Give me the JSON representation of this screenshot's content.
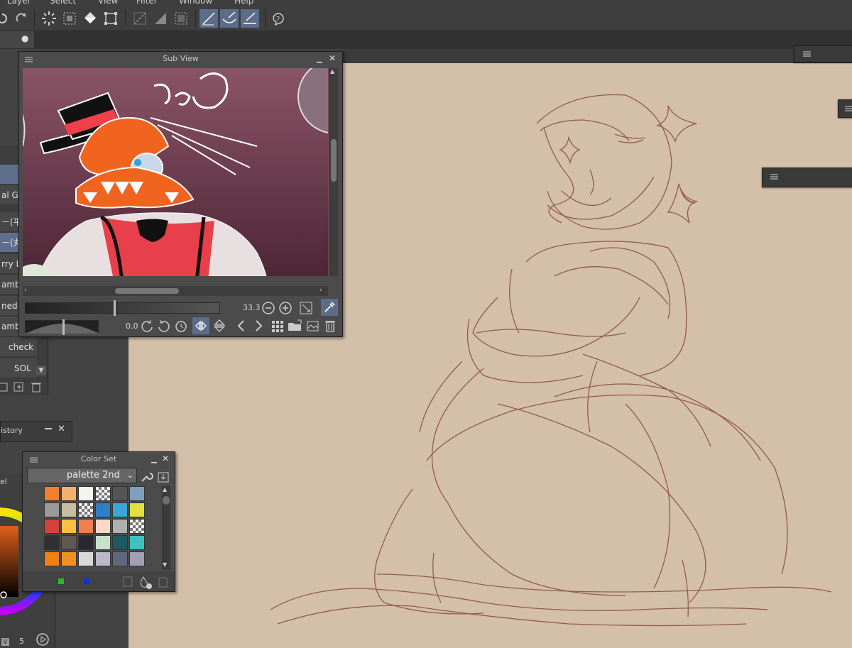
{
  "menu": {
    "items": [
      "Layer",
      "Select",
      "View",
      "Filter",
      "Window",
      "Help"
    ]
  },
  "toolbar": {
    "tools": [
      "redo-icon",
      "fill-icon",
      "selection-icon",
      "bucket-icon",
      "transform-icon",
      "ruler-icon",
      "grid-icon",
      "frame-icon",
      "pen-snap-icon",
      "curve-snap-icon",
      "line-snap-icon",
      "help-icon"
    ]
  },
  "subview": {
    "title": "Sub View",
    "zoom_value": "33.3",
    "rotation_value": "0.0"
  },
  "brushes": {
    "items": [
      {
        "label": "",
        "selected": true
      },
      {
        "label": "al G-l",
        "selected": false
      },
      {
        "label": "－(平",
        "selected": false
      },
      {
        "label": "－(丸",
        "selected": true
      },
      {
        "label": "rry L",
        "selected": false
      },
      {
        "label": "amb",
        "selected": false
      },
      {
        "label": "ned S",
        "selected": false
      },
      {
        "label": "amb",
        "selected": false
      },
      {
        "label": "check",
        "selected": false
      },
      {
        "label": "SOL",
        "selected": false
      }
    ]
  },
  "history": {
    "title": "istory"
  },
  "colorset": {
    "title": "Color Set",
    "palette_name": "palette 2nd",
    "swatches": [
      [
        "#f08030",
        "#f6b070",
        "#f5f5f0",
        "checker",
        "#555555",
        "#7e9fc0"
      ],
      [
        "#9a9a9a",
        "#c8bda0",
        "checker",
        "#2f7fc8",
        "#39a8d8",
        "#e0e040"
      ],
      [
        "#d84040",
        "#f8c040",
        "#f08050",
        "#f8d8c8",
        "#b0b0b0",
        "checker"
      ],
      [
        "#303030",
        "#605850",
        "#282830",
        "#c8e0c8",
        "#1e5a60",
        "#40c0c0"
      ],
      [
        "#f08010",
        "#f09020",
        "#d8d8d8",
        "#b8b8c8",
        "#606880",
        "#a0a0b0"
      ]
    ]
  },
  "colorwheel": {
    "title": "el",
    "value_label": "5"
  },
  "colors": {
    "accent": "#5b6d8a",
    "canvas": "#d4bfa8",
    "panel": "#4b4b4b"
  }
}
